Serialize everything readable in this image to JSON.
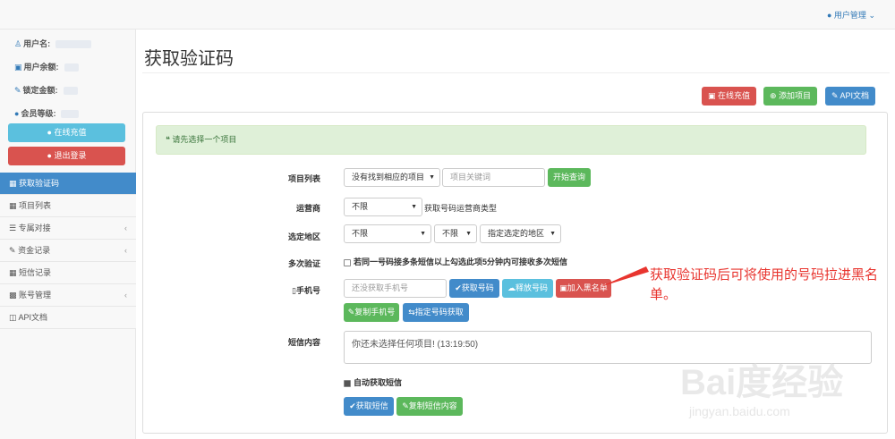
{
  "topbar": {
    "user_menu": "用户管理"
  },
  "sidebar": {
    "username_label": "用户名:",
    "balance_label": "用户余额:",
    "locked_label": "锁定金额:",
    "level_label": "会员等级:",
    "recharge_btn": "在线充值",
    "logout_btn": "退出登录",
    "nav": [
      {
        "label": "获取验证码"
      },
      {
        "label": "项目列表"
      },
      {
        "label": "专属对接"
      },
      {
        "label": "资金记录"
      },
      {
        "label": "短信记录"
      },
      {
        "label": "账号管理"
      },
      {
        "label": "API文档"
      }
    ]
  },
  "main": {
    "title": "获取验证码",
    "recharge_btn": "在线充值",
    "add_project_btn": "添加项目",
    "api_doc_btn": "API文档",
    "alert": "请先选择一个项目",
    "project_list_label": "项目列表",
    "project_select": "没有找到相应的项目",
    "keyword_placeholder": "项目关键词",
    "search_btn": "开始查询",
    "carrier_label": "运营商",
    "carrier_select": "不限",
    "carrier_hint": "获取号码运营商类型",
    "region_label": "选定地区",
    "region_select1": "不限",
    "region_select2": "不限",
    "region_select3": "指定选定的地区",
    "multi_label": "多次验证",
    "multi_text": "若同一号码接多条短信以上勾选此项5分钟内可接收多次短信",
    "phone_label": "手机号",
    "phone_placeholder": "还没获取手机号",
    "get_number_btn": "获取号码",
    "release_btn": "释放号码",
    "blacklist_btn": "加入黑名单",
    "copy_phone_btn": "复制手机号",
    "assign_btn": "指定号码获取",
    "sms_label": "短信内容",
    "sms_content": "你还未选择任何项目! (13:19:50)",
    "auto_get_label": "自动获取短信",
    "get_sms_btn": "获取短信",
    "copy_sms_btn": "复制短信内容"
  },
  "annotation": "获取验证码后可将使用的号码拉进黑名单。",
  "watermark": {
    "logo": "Bai度经验",
    "url": "jingyan.baidu.com"
  }
}
